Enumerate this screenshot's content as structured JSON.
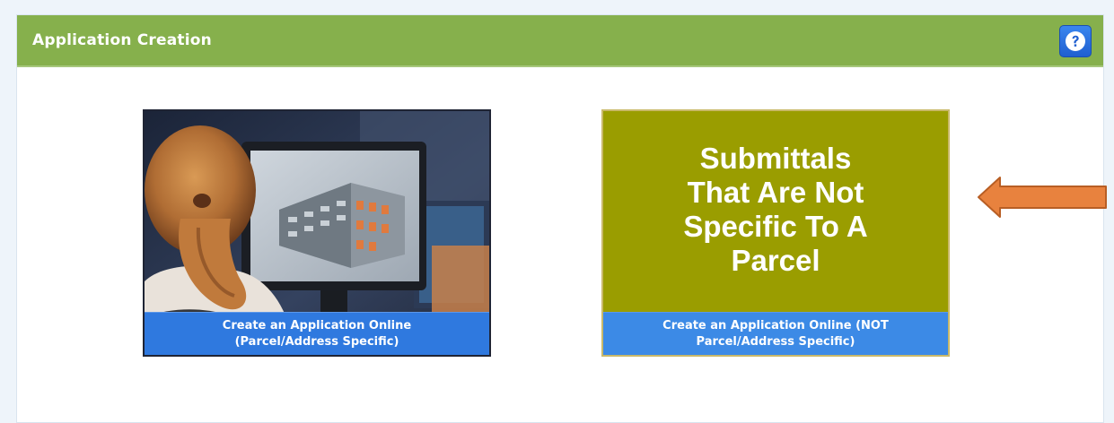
{
  "panel": {
    "title": "Application Creation",
    "help_icon": "question-mark-icon"
  },
  "tiles": [
    {
      "image": "person-viewing-3d-building-model-photo",
      "caption_line1": "Create an Application Online",
      "caption_line2": "(Parcel/Address Specific)"
    },
    {
      "headline_lines": [
        "Submittals",
        "That Are Not",
        "Specific To A",
        "Parcel"
      ],
      "caption_line1": "Create an Application Online (NOT",
      "caption_line2": "Parcel/Address Specific)",
      "background_color": "#9a9d00"
    }
  ],
  "annotation": {
    "icon": "left-arrow-icon",
    "color": "#e8823e"
  },
  "colors": {
    "header": "#86b04c",
    "caption_bar": "#2f79df",
    "help_button": "#2a6fe0"
  }
}
